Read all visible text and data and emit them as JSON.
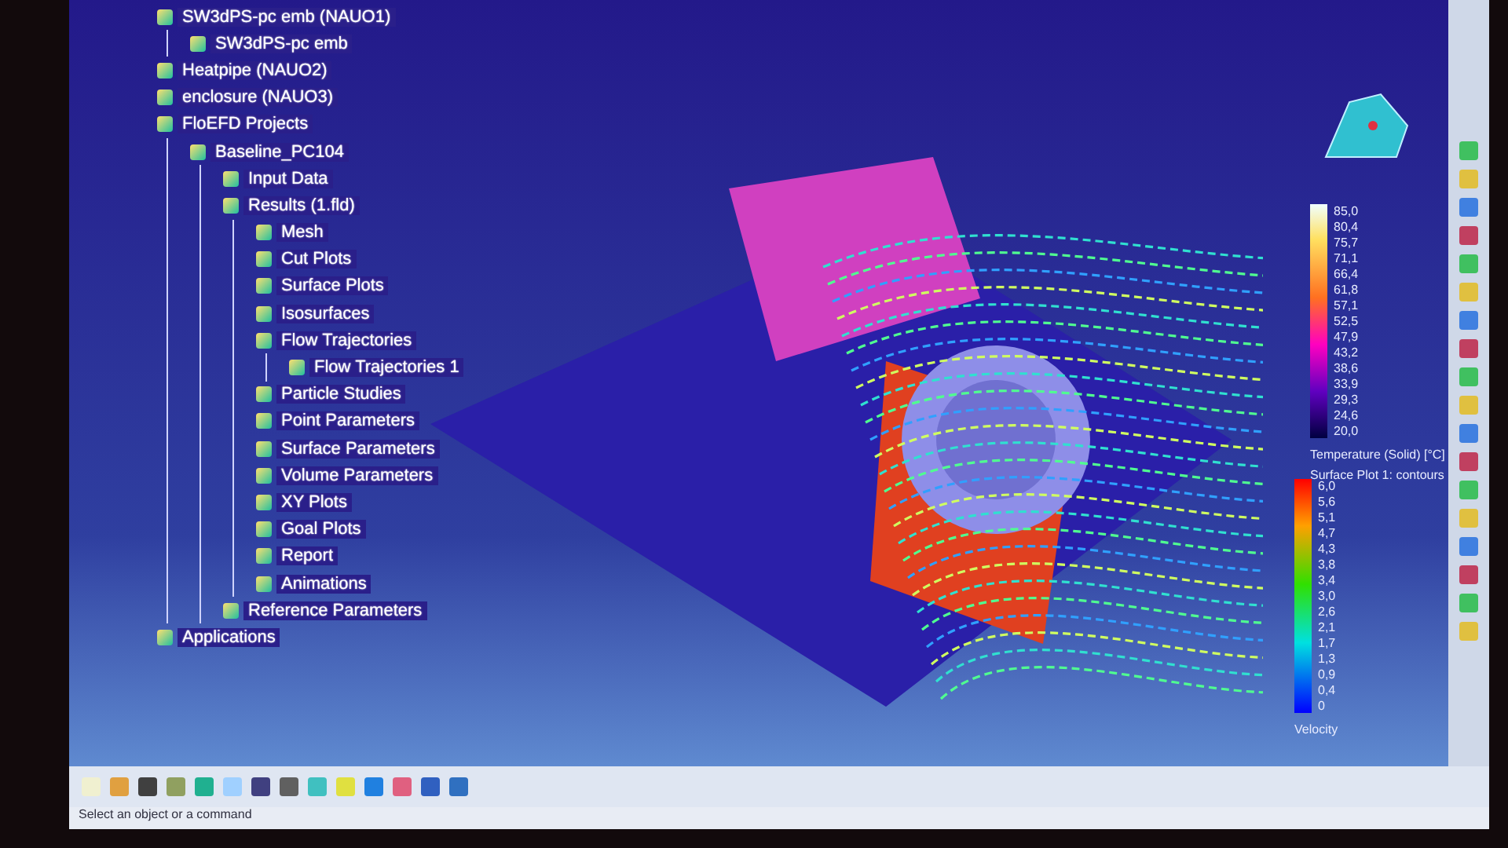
{
  "tree": [
    {
      "label": "SW3dPS-pc emb (NAUO1)",
      "children": [
        {
          "label": "SW3dPS-pc emb"
        }
      ]
    },
    {
      "label": "Heatpipe (NAUO2)"
    },
    {
      "label": "enclosure (NAUO3)"
    },
    {
      "label": "FloEFD Projects",
      "children": [
        {
          "label": "Baseline_PC104",
          "children": [
            {
              "label": "Input Data"
            },
            {
              "label": "Results (1.fld)",
              "children": [
                {
                  "label": "Mesh"
                },
                {
                  "label": "Cut Plots"
                },
                {
                  "label": "Surface Plots"
                },
                {
                  "label": "Isosurfaces"
                },
                {
                  "label": "Flow Trajectories",
                  "children": [
                    {
                      "label": "Flow Trajectories 1"
                    }
                  ]
                },
                {
                  "label": "Particle Studies"
                },
                {
                  "label": "Point Parameters"
                },
                {
                  "label": "Surface Parameters"
                },
                {
                  "label": "Volume Parameters"
                },
                {
                  "label": "XY Plots"
                },
                {
                  "label": "Goal Plots"
                },
                {
                  "label": "Report"
                },
                {
                  "label": "Animations"
                }
              ]
            },
            {
              "label": "Reference Parameters"
            }
          ]
        }
      ]
    },
    {
      "label": "Applications"
    }
  ],
  "legends": [
    {
      "kind": "temperature",
      "values": [
        "85,0",
        "80,4",
        "75,7",
        "71,1",
        "66,4",
        "61,8",
        "57,1",
        "52,5",
        "47,9",
        "43,2",
        "38,6",
        "33,9",
        "29,3",
        "24,6",
        "20,0"
      ],
      "title": "Temperature (Solid) [°C]",
      "subtitle": "Surface Plot 1: contours"
    },
    {
      "kind": "velocity",
      "values": [
        "6,0",
        "5,6",
        "5,1",
        "4,7",
        "4,3",
        "3,8",
        "3,4",
        "3,0",
        "2,6",
        "2,1",
        "1,7",
        "1,3",
        "0,9",
        "0,4",
        "0"
      ],
      "title": "Velocity"
    }
  ],
  "status_bar": {
    "text": "Select an object or a command"
  }
}
